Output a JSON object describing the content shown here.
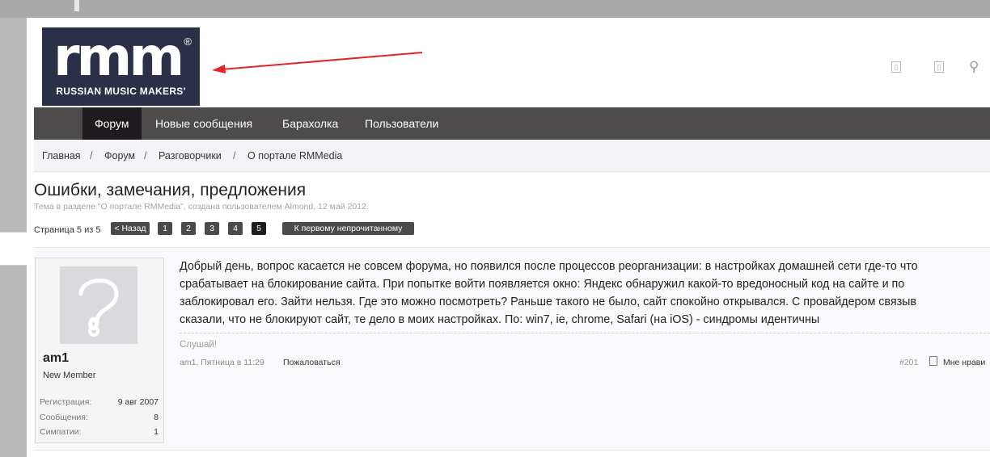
{
  "logo": {
    "mark": "rmm",
    "registered": "®",
    "tagline": "RUSSIAN MUSIC MAKERS'"
  },
  "header": {
    "icons": [
      "doc-icon",
      "doc-icon",
      "search-icon"
    ]
  },
  "nav": {
    "items": [
      {
        "label": "Форум",
        "active": true
      },
      {
        "label": "Новые сообщения",
        "active": false
      },
      {
        "label": "Барахолка",
        "active": false
      },
      {
        "label": "Пользователи",
        "active": false
      }
    ]
  },
  "breadcrumb": {
    "items": [
      "Главная",
      "Форум",
      "Разговорчики",
      "О портале RMMedia"
    ],
    "separator": "/"
  },
  "thread": {
    "title": "Ошибки, замечания, предложения",
    "subtitle": "Тема в разделе \"О портале RMMedia\", создана пользователем Almond, 12 май 2012."
  },
  "pager": {
    "label": "Страница 5 из 5",
    "prev": "< Назад",
    "pages": [
      "1",
      "2",
      "3",
      "4",
      "5"
    ],
    "current": "5",
    "first_unread": "К первому непрочитанному"
  },
  "post": {
    "user": {
      "name": "am1",
      "title": "New Member",
      "stats": [
        {
          "label": "Регистрация:",
          "value": "9 авг 2007"
        },
        {
          "label": "Сообщения:",
          "value": "8"
        },
        {
          "label": "Симпатии:",
          "value": "1"
        }
      ]
    },
    "lines": [
      "Добрый день, вопрос касается не совсем форума, но появился после процессов реорганизации: в настройках домашней сети где-то что",
      "срабатывает на блокирование сайта. При попытке войти появляется окно: Яндекс обнаружил какой-то вредоносный код на сайте и по",
      "заблокировал его. Зайти нельзя. Где это можно посмотреть? Раньше такого не было, сайт спокойно открывался. С провайдером связыв",
      "сказали, что не блокируют сайт, те дело в моих настройках. По: win7, ie, chrome, Safari (на iOS) - синдромы идентичны"
    ],
    "signature": "Слушай!",
    "meta": "am1, Пятница в 11:29",
    "report": "Пожаловаться",
    "number": "#201",
    "like": "Мне нрави"
  },
  "colors": {
    "navbar": "#4e4b4d",
    "nav_active": "#1e1a1e",
    "logo_bg": "#2b3048",
    "annotation_arrow": "#e0262a"
  }
}
